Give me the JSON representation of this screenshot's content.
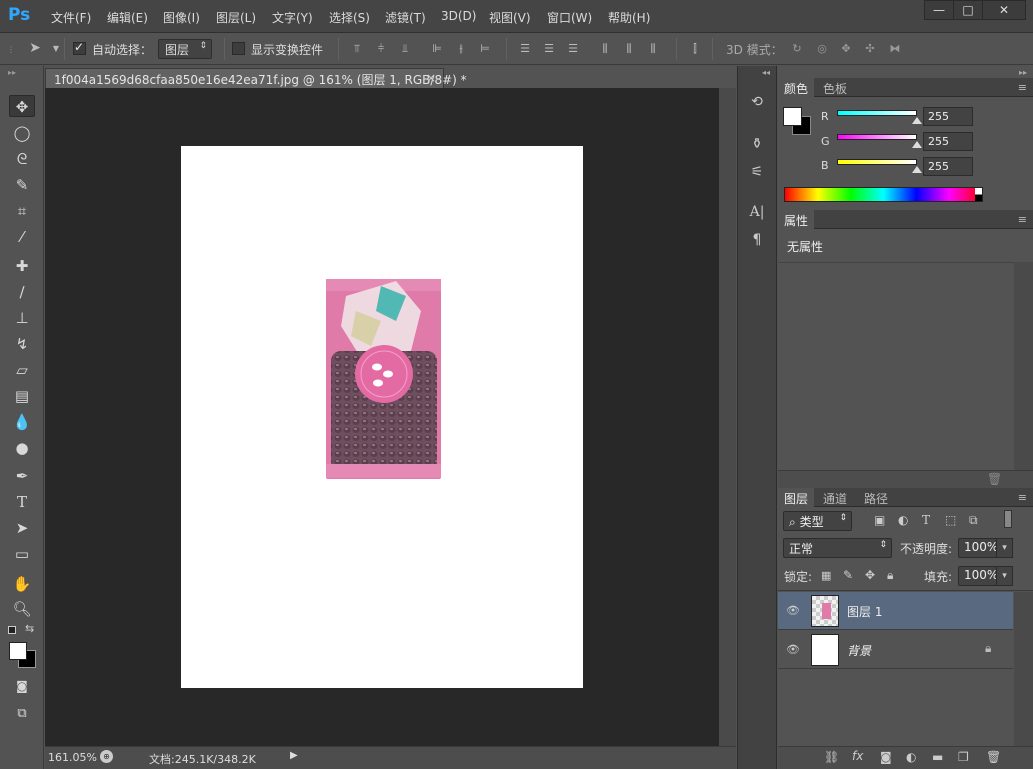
{
  "app": {
    "logo": "Ps",
    "menu": [
      "文件(F)",
      "编辑(E)",
      "图像(I)",
      "图层(L)",
      "文字(Y)",
      "选择(S)",
      "滤镜(T)",
      "3D(D)",
      "视图(V)",
      "窗口(W)",
      "帮助(H)"
    ],
    "window_buttons": [
      "—",
      "□",
      "✕"
    ]
  },
  "options_bar": {
    "auto_select_label": "自动选择：",
    "auto_select_checked": true,
    "auto_select_target": "图层",
    "show_transform_label": "显示变换控件",
    "show_transform_checked": false,
    "mode_3d_label": "3D 模式："
  },
  "document": {
    "tab_title": "1f004a1569d68cfaa850e16e42ea71f.jpg @ 161% (图层 1, RGB/8#) *",
    "close_glyph": "×",
    "zoom": "161.05%",
    "doc_size": "文档:245.1K/348.2K"
  },
  "color_panel": {
    "tabs": [
      "颜色",
      "色板"
    ],
    "channels": [
      {
        "label": "R",
        "value": "255"
      },
      {
        "label": "G",
        "value": "255"
      },
      {
        "label": "B",
        "value": "255"
      }
    ]
  },
  "properties_panel": {
    "tab": "属性",
    "content": "无属性"
  },
  "layers_panel": {
    "tabs": [
      "图层",
      "通道",
      "路径"
    ],
    "filter_kind": "类型",
    "blend_mode": "正常",
    "opacity_label": "不透明度:",
    "opacity": "100%",
    "lock_label": "锁定:",
    "fill_label": "填充:",
    "fill": "100%",
    "layers": [
      {
        "name": "图层 1",
        "selected": true,
        "locked": false
      },
      {
        "name": "背景",
        "selected": false,
        "locked": true
      }
    ]
  },
  "colors": {
    "accent": "#31a8ff",
    "selected_layer": "#596a80",
    "product_pink": "#e07aa8"
  }
}
